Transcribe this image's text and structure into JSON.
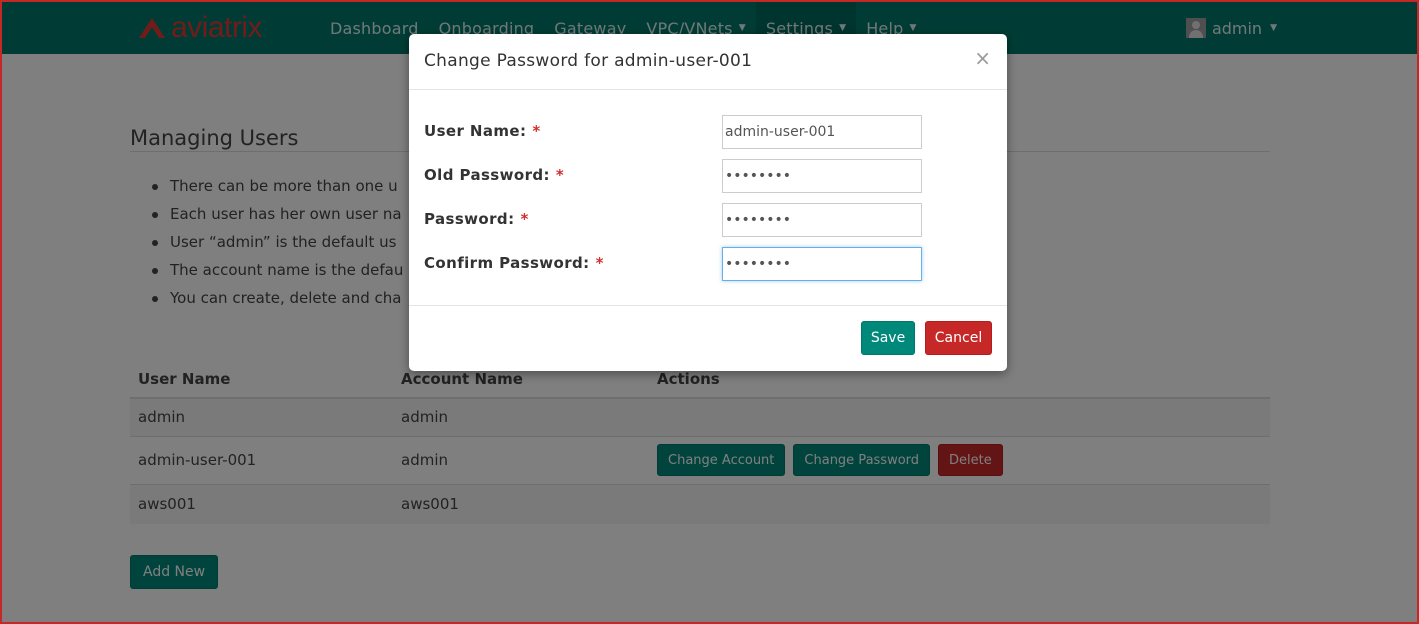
{
  "navbar": {
    "brand": "aviatrix",
    "items": [
      {
        "label": "Dashboard",
        "dropdown": false
      },
      {
        "label": "Onboarding",
        "dropdown": false
      },
      {
        "label": "Gateway",
        "dropdown": false
      },
      {
        "label": "VPC/VNets",
        "dropdown": true
      },
      {
        "label": "Settings",
        "dropdown": true
      },
      {
        "label": "Help",
        "dropdown": true
      }
    ],
    "user": "admin",
    "caret": "▼"
  },
  "page": {
    "title": "Managing Users",
    "bullets": [
      "There can be more than one u",
      "Each user has her own user na",
      "User “admin” is the default us",
      "The account name is the defau",
      "You can create, delete and cha"
    ],
    "table": {
      "headers": [
        "User Name",
        "Account Name",
        "Actions"
      ],
      "rows": [
        {
          "user": "admin",
          "account": "admin"
        },
        {
          "user": "admin-user-001",
          "account": "admin"
        },
        {
          "user": "aws001",
          "account": "aws001"
        }
      ],
      "actions": {
        "change_account": "Change Account",
        "change_password": "Change Password",
        "delete": "Delete"
      }
    },
    "add_new": "Add New"
  },
  "modal": {
    "title": "Change Password for admin-user-001",
    "close": "×",
    "fields": [
      {
        "label": "User Name:",
        "value": "admin-user-001",
        "type": "text"
      },
      {
        "label": "Old Password:",
        "value": "password",
        "type": "password"
      },
      {
        "label": "Password:",
        "value": "password",
        "type": "password"
      },
      {
        "label": "Confirm Password:",
        "value": "password",
        "type": "password"
      }
    ],
    "required_mark": "*",
    "save": "Save",
    "cancel": "Cancel"
  },
  "colors": {
    "navbar": "#00796b",
    "brand": "#e53935",
    "primary_button": "#00897b",
    "danger_button": "#c62828"
  }
}
